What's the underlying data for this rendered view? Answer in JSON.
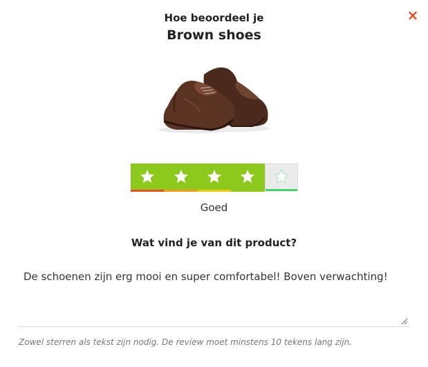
{
  "dialog": {
    "close_label": "×",
    "heading_small": "Hoe beoordeel je",
    "product_name": "Brown shoes"
  },
  "rating": {
    "value": 4,
    "max": 5,
    "label": "Goed",
    "active_color": "#8dc81c",
    "inactive_color": "#ebebeb",
    "bar_colors": [
      "#e94e2c",
      "#f29b1f",
      "#f2c80f",
      "#8dc81c",
      "#3fd66e"
    ]
  },
  "question": "Wat vind je van dit product?",
  "review": {
    "value": "De schoenen zijn erg mooi en super comfortabel! Boven verwachting!"
  },
  "hint": "Zowel sterren als tekst zijn nodig. De review moet minstens 10 tekens lang zijn."
}
